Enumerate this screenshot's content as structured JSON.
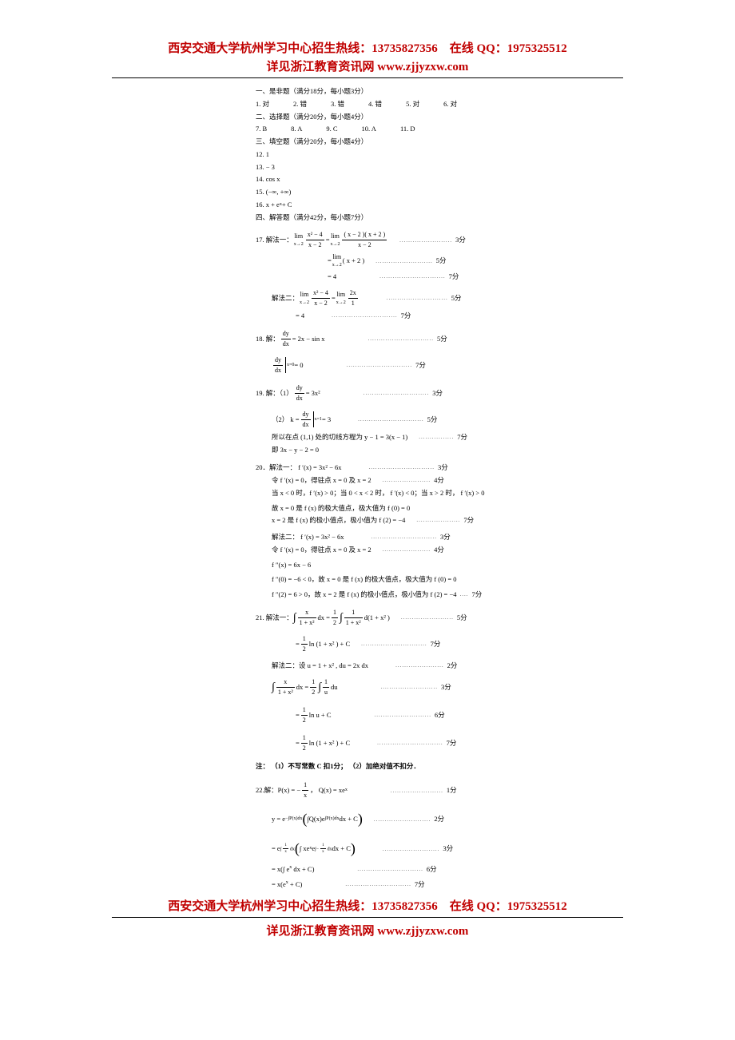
{
  "header": {
    "line1": "西安交通大学杭州学习中心招生热线：13735827356　在线 QQ：1975325512",
    "line2": "详见浙江教育资讯网 www.zjjyzxw.com"
  },
  "sections": {
    "s1_title": "一、是非题（满分18分，每小题3分）",
    "s1_a1": "1. 对",
    "s1_a2": "2. 错",
    "s1_a3": "3. 错",
    "s1_a4": "4. 错",
    "s1_a5": "5. 对",
    "s1_a6": "6. 对",
    "s2_title": "二、选择题（满分20分，每小题4分）",
    "s2_a7": "7. B",
    "s2_a8": "8. A",
    "s2_a9": "9. C",
    "s2_a10": "10. A",
    "s2_a11": "11. D",
    "s3_title": "三、填空题（满分20分，每小题4分）",
    "q12": "12.  1",
    "q13": "13.  − 3",
    "q14": "14.  cos x",
    "q15": "15.  (−∞, +∞)",
    "q16_pre": "16.  x + e",
    "q16_suf": " + C",
    "s4_title": "四、解答题（满分42分，每小题7分）",
    "q17_m1": "17. 解法一：",
    "q17_eq1_lhs_n": "x² − 4",
    "q17_eq1_lhs_d": "x − 2",
    "q17_eq1_rhs_n": "( x − 2 )( x + 2 )",
    "q17_eq1_rhs_d": "x − 2",
    "score3": "3分",
    "q17_l2": "( x + 2 )",
    "score5": "5分",
    "q17_l3": "= 4",
    "score7": "7分",
    "q17_m2": "解法二：",
    "q17_m2_n": "x² − 4",
    "q17_m2_d": "x − 2",
    "q17_m2_rn": "2x",
    "q17_m2_rd": "1",
    "q17_m2_r2": "= 4",
    "q18": "18. 解：",
    "q18_rhs": " = 2x − sin x",
    "q18_b": " = 0",
    "q19": "19. 解：（1）",
    "q19_rhs": " = 3x²",
    "q19_2": "（2）  k = ",
    "q19_2r": " = 3",
    "q19_tan": "所以在点 (1,1) 处的切线方程为 y − 1 = 3(x − 1)",
    "q19_simp": "即 3x − y − 2 = 0",
    "q20_m1": "20．解法一：  f ′(x) = 3x² − 6x",
    "q20_l2": "令  f ′(x) = 0，得驻点 x = 0 及 x = 2",
    "score4": "4分",
    "q20_l3": "当  x < 0 时，f ′(x) > 0；当   0 < x < 2 时， f ′(x) < 0；当  x > 2 时， f ′(x) > 0",
    "q20_l4": "故  x = 0 是 f (x) 的极大值点，极大值为 f (0) = 0",
    "q20_l5": "     x = 2 是 f (x) 的极小值点，极小值为 f (2) = −4",
    "q20_m2": "解法二：  f ′(x) = 3x² − 6x",
    "q20_m2_l2": "令  f ′(x) = 0，得驻点 x = 0 及 x = 2",
    "q20_fpp": "  f ″(x) = 6x − 6",
    "q20_m2_l3": " f ″(0) = −6 < 0，故  x = 0 是 f (x) 的极大值点，极大值为 f (0) = 0",
    "q20_m2_l4": " f ″(2) = 6 > 0，故  x = 2 是 f (x) 的极小值点，极小值为 f (2) = −4 ",
    "q21_m1": "21. 解法一：",
    "q21_int_n": "x",
    "q21_int_d": "1 + x²",
    "q21_half_n": "1",
    "q21_half_d": "2",
    "q21_r_n": "1",
    "q21_r_d": "1 + x²",
    "q21_r_suf": "d(1 + x² )",
    "q21_res": "ln (1 + x² ) + C",
    "q21_m2": "解法二：设 u = 1 + x² ,   du = 2x dx",
    "score2": "2分",
    "q21_m2_r": "du",
    "q21_m2_res1": "ln u + C",
    "score6": "6分",
    "q21_m2_res2": "ln (1 + x² ) + C",
    "note": "注： （1）不写常数 C 扣1分； （2）加绝对值不扣分．",
    "q22": "22.解：",
    "q22_p": "P(x) = −",
    "q22_pn": "1",
    "q22_pd": "x",
    "q22_q": "，  Q(x) = xe",
    "score1": "1分",
    "q22_y": "y = e",
    "q22_exp1": "∫P(x)dx",
    "q22_in1": "∫Q(x)e",
    "q22_in1b": " dx + C",
    "q22_l3a": "= e",
    "q22_exp2n": "1",
    "q22_exp2d": "x",
    "q22_exp2s": "dx",
    "q22_in2a": "∫ xe",
    "q22_in2b": " e",
    "q22_in2c": " dx + C",
    "q22_l4": "= x(∫ e  dx + C)",
    "q22_l5": "= x(e  + C)",
    "lim_lbl": "lim",
    "lim_sub": "x→2",
    "dy": "dy",
    "dx": "dx",
    "x": "x",
    "u": "u",
    "xeq0": "x=0",
    "xeq1": "x=1"
  }
}
